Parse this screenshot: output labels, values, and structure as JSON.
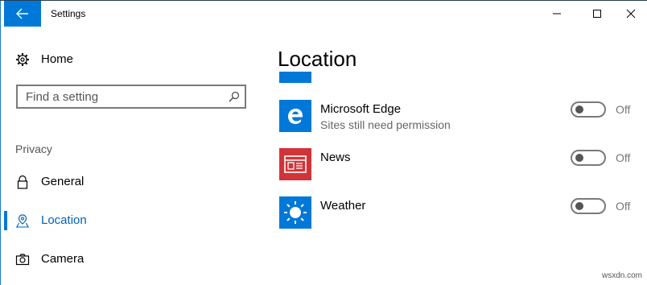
{
  "window": {
    "title": "Settings"
  },
  "nav": {
    "home_label": "Home",
    "search_placeholder": "Find a setting",
    "section_label": "Privacy",
    "items": [
      {
        "label": "General",
        "icon": "lock-icon",
        "selected": false
      },
      {
        "label": "Location",
        "icon": "location-icon",
        "selected": true
      },
      {
        "label": "Camera",
        "icon": "camera-icon",
        "selected": false
      }
    ]
  },
  "main": {
    "title": "Location",
    "apps": [
      {
        "name": "Microsoft Edge",
        "subtitle": "Sites still need permission",
        "toggle_state": "Off",
        "tile_color": "#0078d7",
        "icon": "edge-icon"
      },
      {
        "name": "News",
        "subtitle": "",
        "toggle_state": "Off",
        "tile_color": "#d13438",
        "icon": "news-icon"
      },
      {
        "name": "Weather",
        "subtitle": "",
        "toggle_state": "Off",
        "tile_color": "#0078d7",
        "icon": "weather-icon"
      }
    ]
  },
  "colors": {
    "accent": "#0078d7",
    "news": "#d13438"
  },
  "watermark": "wsxdn.com"
}
